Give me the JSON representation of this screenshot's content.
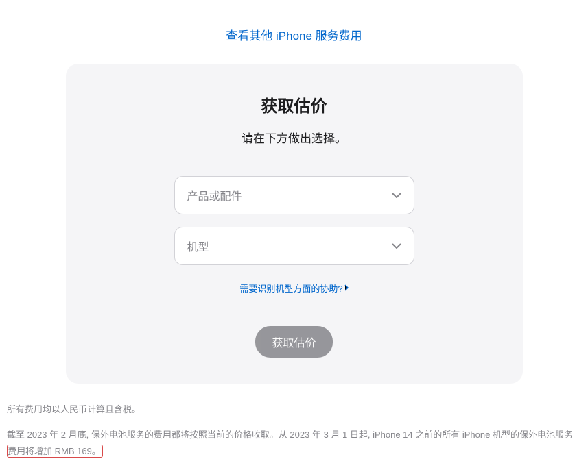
{
  "topLink": "查看其他 iPhone 服务费用",
  "card": {
    "title": "获取估价",
    "subtitle": "请在下方做出选择。",
    "select1Placeholder": "产品或配件",
    "select2Placeholder": "机型",
    "helpLink": "需要识别机型方面的协助? ",
    "submitLabel": "获取估价"
  },
  "notes": {
    "line1": "所有费用均以人民币计算且含税。",
    "line2a": "截至 2023 年 2 月底, 保外电池服务的费用都将按照当前的价格收取。从 2023 年 3 月 1 日起, iPhone 14 之前的所有 iPhone 机型的保外电池服务",
    "line2b": "费用将增加 RMB 169。"
  }
}
